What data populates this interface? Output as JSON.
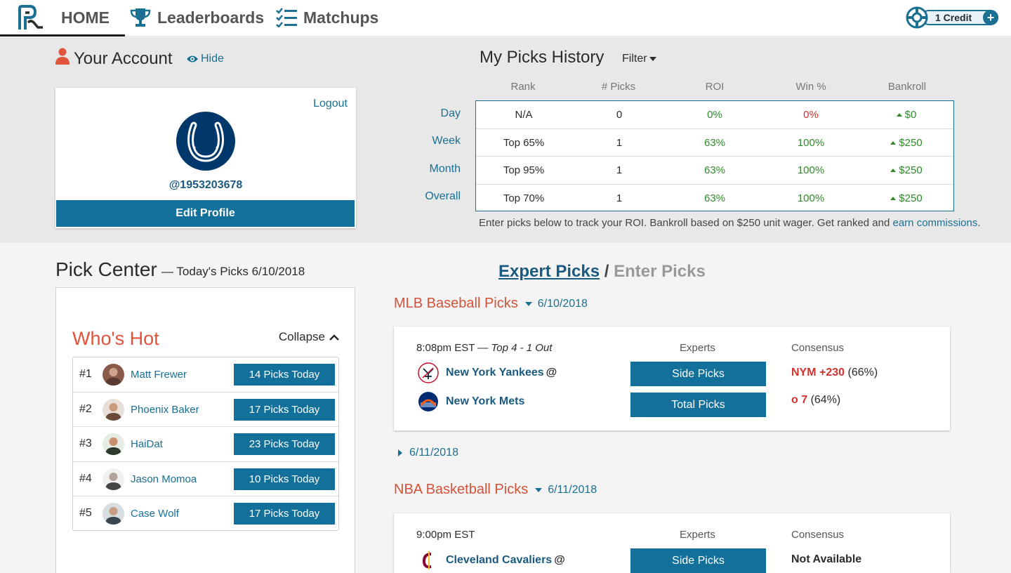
{
  "nav": {
    "items": [
      {
        "label": "HOME",
        "icon": "logo-icon"
      },
      {
        "label": "Leaderboards",
        "icon": "trophy-icon"
      },
      {
        "label": "Matchups",
        "icon": "checklist-icon"
      }
    ],
    "credit_label": "1 Credit",
    "credit_plus": "+"
  },
  "account": {
    "title": "Your Account",
    "hide_label": "Hide",
    "logout_label": "Logout",
    "handle": "@1953203678",
    "edit_label": "Edit Profile"
  },
  "history": {
    "title": "My Picks History",
    "filter_label": "Filter",
    "columns": [
      "Rank",
      "# Picks",
      "ROI",
      "Win %",
      "Bankroll"
    ],
    "rows": [
      {
        "label": "Day",
        "rank": "N/A",
        "picks": "0",
        "roi": "0%",
        "win": "0%",
        "bankroll": "$0"
      },
      {
        "label": "Week",
        "rank": "Top 65%",
        "picks": "1",
        "roi": "63%",
        "win": "100%",
        "bankroll": "$250"
      },
      {
        "label": "Month",
        "rank": "Top 95%",
        "picks": "1",
        "roi": "63%",
        "win": "100%",
        "bankroll": "$250"
      },
      {
        "label": "Overall",
        "rank": "Top 70%",
        "picks": "1",
        "roi": "63%",
        "win": "100%",
        "bankroll": "$250"
      }
    ],
    "note_text": "Enter picks below to track your ROI. Bankroll based on $250 unit wager. Get ranked and ",
    "note_link": "earn commissions",
    "note_end": "."
  },
  "pick_center": {
    "title": "Pick Center",
    "subtitle": "— Today's Picks 6/10/2018",
    "whos_hot": "Who's Hot",
    "collapse_label": "Collapse",
    "hot": [
      {
        "rank": "#1",
        "name": "Matt Frewer",
        "picks": "14 Picks Today"
      },
      {
        "rank": "#2",
        "name": "Phoenix Baker",
        "picks": "17 Picks Today"
      },
      {
        "rank": "#3",
        "name": "HaiDat",
        "picks": "23 Picks Today"
      },
      {
        "rank": "#4",
        "name": "Jason Momoa",
        "picks": "10 Picks Today"
      },
      {
        "rank": "#5",
        "name": "Case Wolf",
        "picks": "17 Picks Today"
      }
    ]
  },
  "expert": {
    "tab_expert": "Expert Picks",
    "tab_sep": "/",
    "tab_enter": "Enter Picks",
    "mlb_title": "MLB Baseball Picks",
    "mlb_date": "6/10/2018",
    "mlb_game": {
      "time": "8:08pm EST — ",
      "status": "Top 4 - 1 Out",
      "experts_label": "Experts",
      "consensus_label": "Consensus",
      "away": "New York Yankees",
      "at": "@",
      "home": "New York Mets",
      "side_btn": "Side Picks",
      "total_btn": "Total Picks",
      "cons1_hl": "NYM +230",
      "cons1_pct": " (66%)",
      "cons2_hl": "o 7",
      "cons2_pct": " (64%)"
    },
    "next_date": "6/11/2018",
    "nba_title": "NBA Basketball Picks",
    "nba_date": "6/11/2018",
    "nba_game": {
      "time": "9:00pm EST",
      "experts_label": "Experts",
      "consensus_label": "Consensus",
      "away": "Cleveland Cavaliers",
      "at": "@",
      "side_btn": "Side Picks",
      "consensus": "Not Available"
    }
  },
  "colors": {
    "brand_blue": "#13709a",
    "link_blue": "#1a6f93",
    "sport_orange": "#d2533a",
    "positive_green": "#2f8a2a",
    "negative_red": "#d3312d"
  }
}
